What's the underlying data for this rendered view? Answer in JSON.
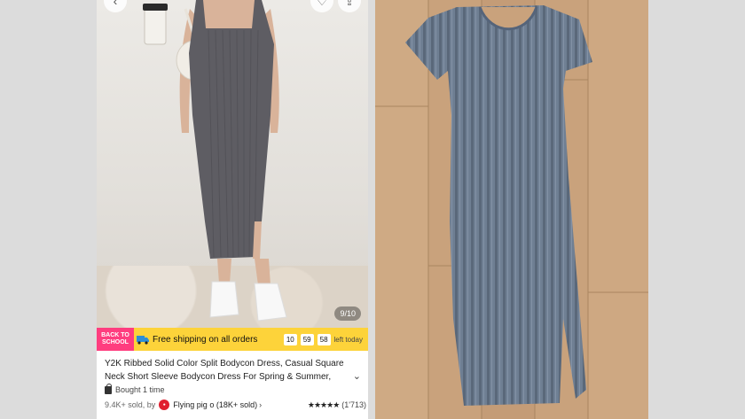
{
  "left_panel": {
    "photo_counter": "9/10",
    "promo": {
      "badge": "BACK TO SCHOOL",
      "text": "Free shipping on all orders",
      "timer": [
        "10",
        "59",
        "58"
      ],
      "timer_suffix": "left today"
    },
    "product": {
      "title": "Y2K Ribbed Solid Color Split Bodycon Dress, Casual Square Neck Short Sleeve Bodycon Dress For Spring & Summer,",
      "bought": "Bought 1 time",
      "sold": "9.4K+ sold, by",
      "seller": "Flying pig o (18K+ sold)",
      "rating_stars": "★★★★★",
      "review_count": "(1'713)"
    }
  },
  "colors": {
    "promo_bg": "#fdd33a",
    "badge_bg": "#ff3d7f",
    "dress_gray": "#5e5d63",
    "dress_blue_gray": "#6f7f93",
    "wood": "#c7a07a"
  }
}
